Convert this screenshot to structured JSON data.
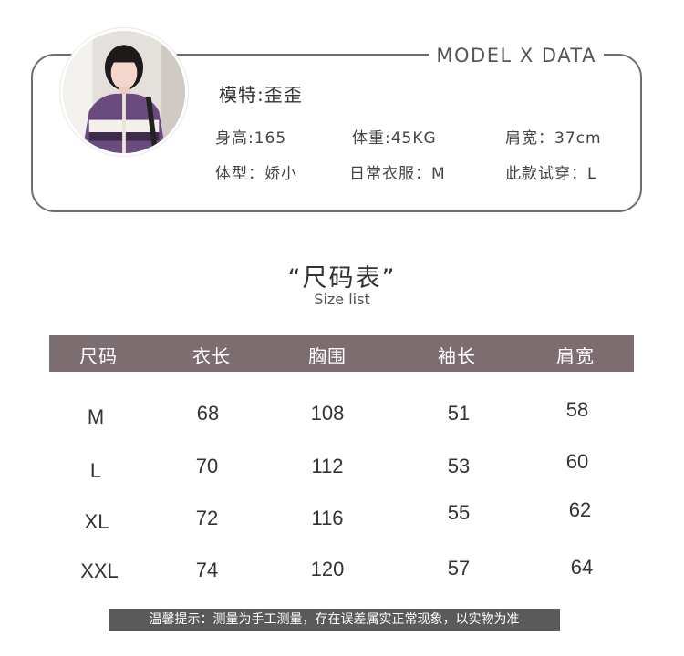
{
  "model": {
    "header": "MODEL X DATA",
    "name_label": "模特:",
    "name": "歪歪",
    "stats": [
      {
        "label": "身高:",
        "value": "165"
      },
      {
        "label": "体重:",
        "value": "45KG"
      },
      {
        "label": "肩宽：",
        "value": "37cm"
      },
      {
        "label": "体型：",
        "value": "娇小"
      },
      {
        "label": "日常衣服：",
        "value": "M"
      },
      {
        "label": "此款试穿：",
        "value": "L"
      }
    ]
  },
  "size_chart": {
    "title": "“尺码表”",
    "subtitle": "Size list",
    "headers": [
      "尺码",
      "衣长",
      "胸围",
      "袖长",
      "肩宽"
    ],
    "rows": [
      [
        "M",
        "68",
        "108",
        "51",
        "58"
      ],
      [
        "L",
        "70",
        "112",
        "53",
        "60"
      ],
      [
        "XL",
        "72",
        "116",
        "55",
        "62"
      ],
      [
        "XXL",
        "74",
        "120",
        "57",
        "64"
      ]
    ]
  },
  "note": "温馨提示：测量为手工测量，存在误差属实正常现象，以实物为准",
  "colors": {
    "table_header_bg": "#7b6d70",
    "note_bg": "#5a5a5a",
    "jacket_purple": "#6b4a7e"
  }
}
